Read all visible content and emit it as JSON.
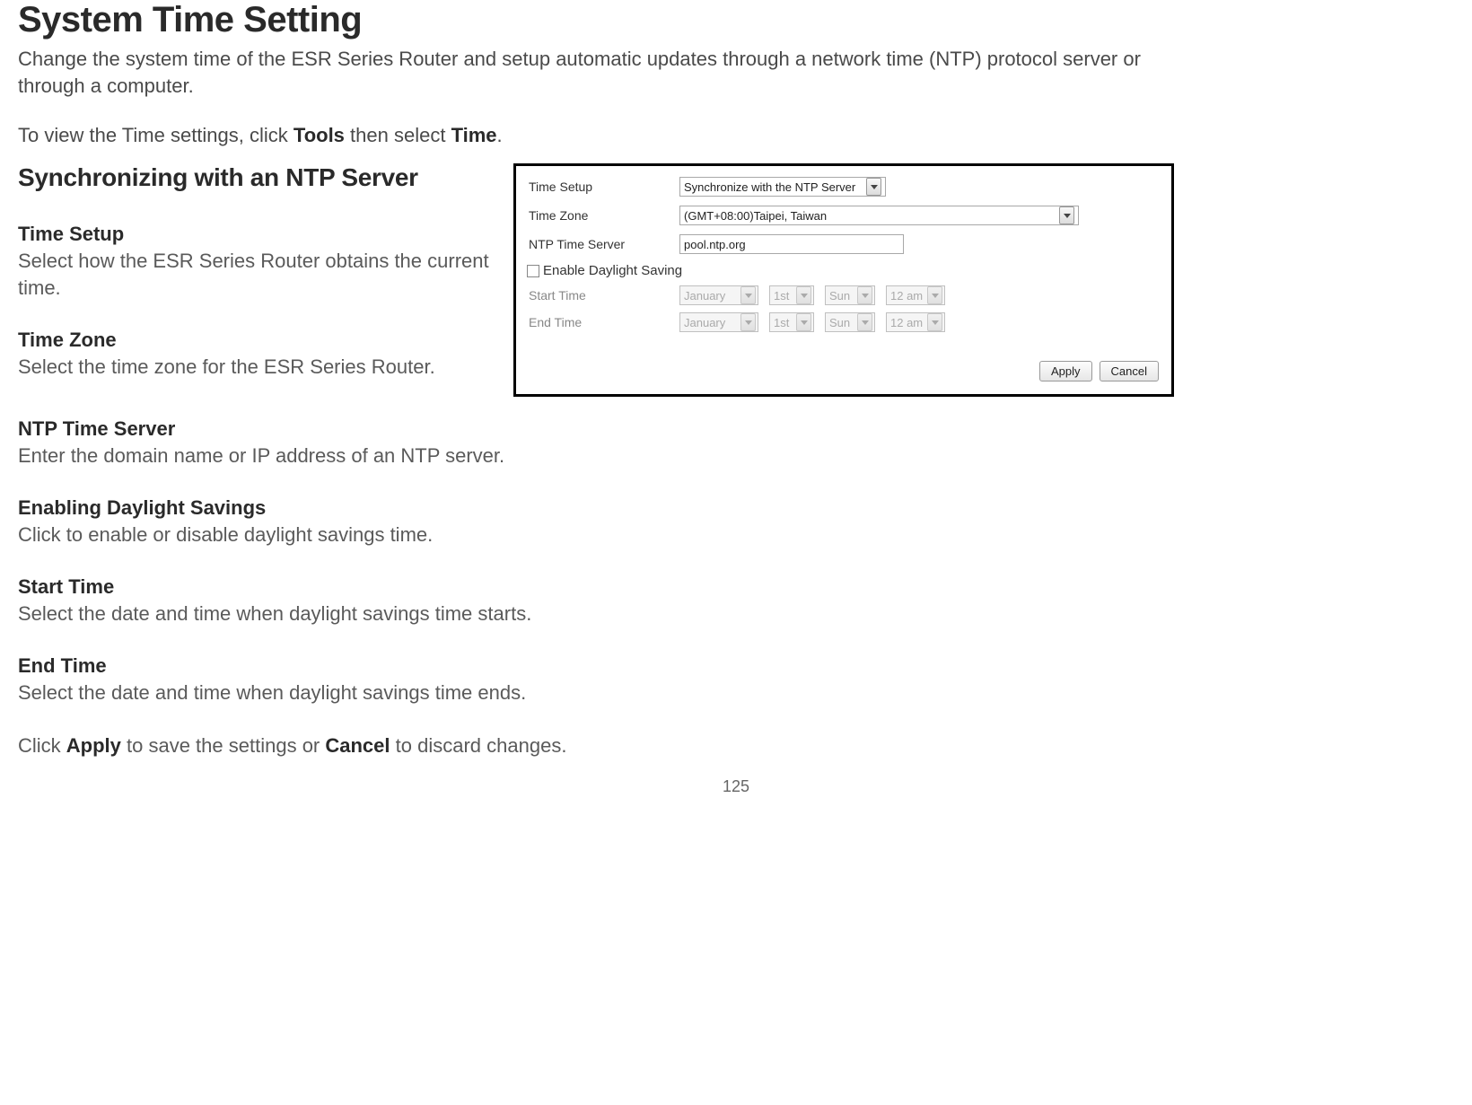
{
  "page": {
    "title": "System Time Setting",
    "intro": "Change the system time of the ESR Series Router and setup automatic updates through a network time (NTP) protocol server or through a computer.",
    "nav_prefix": "To view the Time settings, click ",
    "nav_bold1": "Tools",
    "nav_mid": " then select ",
    "nav_bold2": "Time",
    "nav_suffix": ".",
    "subheading": "Synchronizing with an NTP Server",
    "page_number": "125"
  },
  "defs": {
    "time_setup": {
      "title": "Time Setup",
      "body": "Select how the ESR Series Router obtains the current time."
    },
    "time_zone": {
      "title": "Time Zone",
      "body": "Select the time zone for the ESR Series Router."
    },
    "ntp": {
      "title": "NTP Time Server",
      "body": "Enter the domain name or IP address of an NTP server."
    },
    "dst_enable": {
      "title": "Enabling Daylight Savings",
      "body": "Click to enable or disable daylight savings time."
    },
    "start_time": {
      "title": "Start Time",
      "body": "Select the date and time when daylight savings time starts."
    },
    "end_time": {
      "title": "End Time",
      "body": "Select the date and time when daylight savings time ends."
    },
    "apply_line_prefix": "Click ",
    "apply_bold": "Apply",
    "apply_mid": " to save the settings or ",
    "cancel_bold": "Cancel",
    "apply_suffix": " to discard changes."
  },
  "panel": {
    "labels": {
      "time_setup": "Time Setup",
      "time_zone": "Time Zone",
      "ntp": "NTP Time Server",
      "checkbox": "Enable Daylight Saving",
      "start_time": "Start Time",
      "end_time": "End Time"
    },
    "values": {
      "time_setup": "Synchronize with the NTP Server",
      "time_zone": "(GMT+08:00)Taipei, Taiwan",
      "ntp": "pool.ntp.org",
      "start_month": "January",
      "start_ord": "1st",
      "start_day": "Sun",
      "start_hour": "12 am",
      "end_month": "January",
      "end_ord": "1st",
      "end_day": "Sun",
      "end_hour": "12 am"
    },
    "buttons": {
      "apply": "Apply",
      "cancel": "Cancel"
    }
  }
}
